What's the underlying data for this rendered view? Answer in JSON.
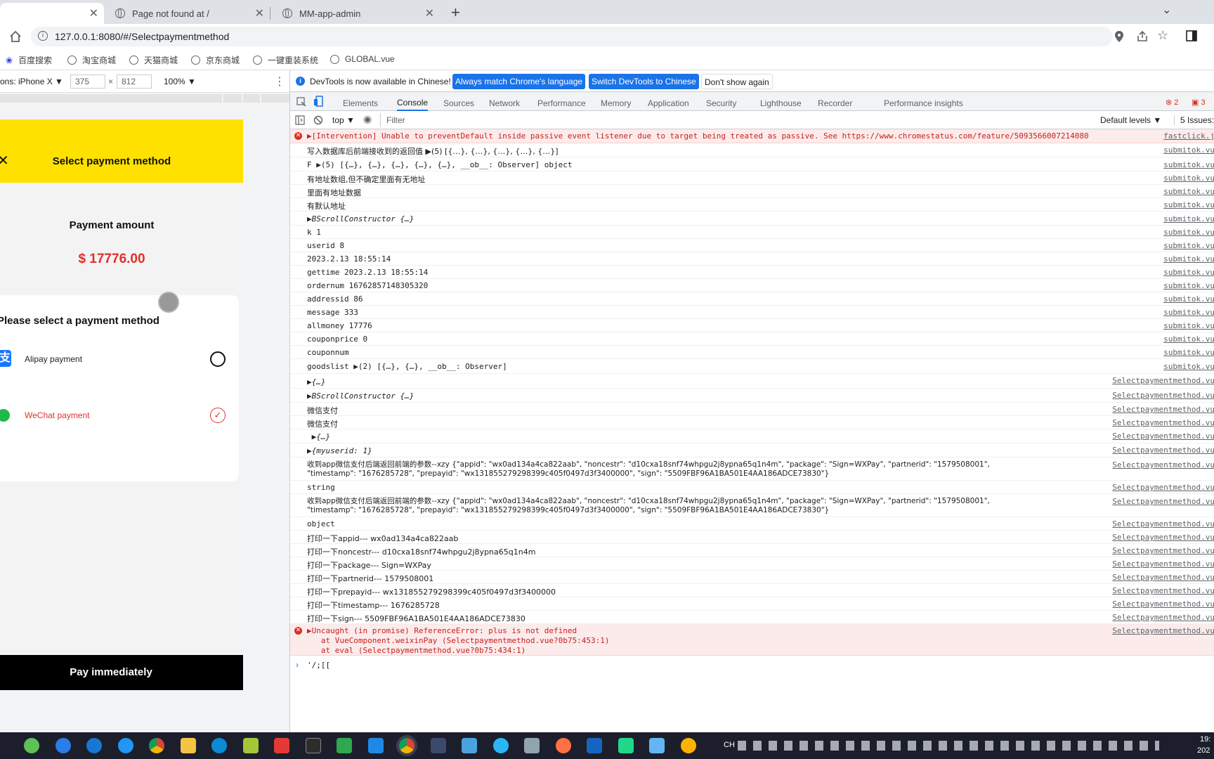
{
  "browser": {
    "tabs": [
      {
        "title": ""
      },
      {
        "title": "Page not found at /"
      },
      {
        "title": "MM-app-admin"
      }
    ],
    "url": "127.0.0.1:8080/#/Selectpaymentmethod",
    "bookmarks": [
      "百度搜索",
      "淘宝商城",
      "天猫商城",
      "京东商城",
      "一键重装系统",
      "GLOBAL.vue"
    ]
  },
  "device": {
    "label": "ons: iPhone X ▼",
    "width": "375",
    "height": "812",
    "zoom": "100% ▼"
  },
  "app": {
    "header_title": "Select payment method",
    "amount_label": "Payment amount",
    "amount_value": "$ 17776.00",
    "select_title": "Please select a payment method",
    "alipay_label": "Alipay payment",
    "alipay_icon": "支",
    "wechat_label": "WeChat payment",
    "pay_button": "Pay immediately",
    "colors": {
      "header": "#ffe100",
      "amount": "#e0312b",
      "wechat": "#e0312b",
      "pay_bg": "#000000"
    }
  },
  "devtools": {
    "banner_text": "DevTools is now available in Chinese!",
    "banner_btn1": "Always match Chrome's language",
    "banner_btn2": "Switch DevTools to Chinese",
    "banner_btn3": "Don't show again",
    "tabs": [
      "Elements",
      "Console",
      "Sources",
      "Network",
      "Performance",
      "Memory",
      "Application",
      "Security",
      "Lighthouse",
      "Recorder",
      "Performance insights"
    ],
    "error_count": "2",
    "warn_count": "3",
    "context": "top ▼",
    "filter_placeholder": "Filter",
    "levels": "Default levels ▼",
    "issues": "5 Issues:",
    "prompt": "'/;[["
  },
  "console": [
    {
      "type": "error",
      "msg": "▶[Intervention] Unable to preventDefault inside passive event listener due to target being treated as passive. See https://www.chromestatus.com/feature/5093566007214080",
      "src": "fastclick.j"
    },
    {
      "type": "log",
      "msg": "写入数据库后前端接收到的返回值 ▶(5) [{…}, {…}, {…}, {…}, {…}]",
      "src": "submitok.vu"
    },
    {
      "type": "log",
      "msg": "F ▶(5) [{…}, {…}, {…}, {…}, {…}, __ob__: Observer] object",
      "src": "submitok.vu"
    },
    {
      "type": "log",
      "msg": "有地址数组,但不确定里面有无地址",
      "src": "submitok.vu"
    },
    {
      "type": "log",
      "msg": "里面有地址数据",
      "src": "submitok.vu"
    },
    {
      "type": "log",
      "msg": "有默认地址",
      "src": "submitok.vu"
    },
    {
      "type": "log",
      "msg": "▶BScrollConstructor {…}",
      "src": "submitok.vu"
    },
    {
      "type": "log",
      "msg": "k 1",
      "src": "submitok.vu"
    },
    {
      "type": "log",
      "msg": "userid 8",
      "src": "submitok.vu"
    },
    {
      "type": "log",
      "msg": "2023.2.13 18:55:14",
      "src": "submitok.vu"
    },
    {
      "type": "log",
      "msg": "gettime 2023.2.13 18:55:14",
      "src": "submitok.vu"
    },
    {
      "type": "log",
      "msg": "ordernum 16762857148305320",
      "src": "submitok.vu"
    },
    {
      "type": "log",
      "msg": "addressid 86",
      "src": "submitok.vu"
    },
    {
      "type": "log",
      "msg": "message 333",
      "src": "submitok.vu"
    },
    {
      "type": "log",
      "msg": "allmoney 17776",
      "src": "submitok.vu"
    },
    {
      "type": "log",
      "msg": "couponprice 0",
      "src": "submitok.vu"
    },
    {
      "type": "log",
      "msg": "couponnum",
      "src": "submitok.vu"
    },
    {
      "type": "log",
      "msg": "goodslist ▶(2) [{…}, {…}, __ob__: Observer]",
      "src": "submitok.vu"
    },
    {
      "type": "log",
      "msg": "▶{…}",
      "src": "Selectpaymentmethod.vu"
    },
    {
      "type": "log",
      "msg": "▶BScrollConstructor {…}",
      "src": "Selectpaymentmethod.vu"
    },
    {
      "type": "log",
      "msg": "微信支付",
      "src": "Selectpaymentmethod.vu"
    },
    {
      "type": "log",
      "msg": "微信支付",
      "src": "Selectpaymentmethod.vu"
    },
    {
      "type": "log",
      "msg": " ▶{…}",
      "src": "Selectpaymentmethod.vu"
    },
    {
      "type": "log",
      "msg": "▶{myuserid: 1}",
      "src": "Selectpaymentmethod.vu"
    },
    {
      "type": "log2",
      "msg": "收到app微信支付后端返回前端的参数--xzy {\"appid\": \"wx0ad134a4ca822aab\", \"noncestr\": \"d10cxa18snf74whpgu2j8ypna65q1n4m\", \"package\": \"Sign=WXPay\", \"partnerid\": \"1579508001\",\n\"timestamp\": \"1676285728\", \"prepayid\": \"wx131855279298399c405f0497d3f3400000\", \"sign\": \"5509FBF96A1BA501E4AA186ADCE73830\"}",
      "src": "Selectpaymentmethod.vu"
    },
    {
      "type": "log",
      "msg": "string",
      "src": "Selectpaymentmethod.vu"
    },
    {
      "type": "log2",
      "msg": "收到app微信支付后端返回前端的参数--xzy {\"appid\": \"wx0ad134a4ca822aab\", \"noncestr\": \"d10cxa18snf74whpgu2j8ypna65q1n4m\", \"package\": \"Sign=WXPay\", \"partnerid\": \"1579508001\",\n\"timestamp\": \"1676285728\", \"prepayid\": \"wx131855279298399c405f0497d3f3400000\", \"sign\": \"5509FBF96A1BA501E4AA186ADCE73830\"}",
      "src": "Selectpaymentmethod.vu"
    },
    {
      "type": "log",
      "msg": "object",
      "src": "Selectpaymentmethod.vu"
    },
    {
      "type": "log",
      "msg": "打印一下appid--- wx0ad134a4ca822aab",
      "src": "Selectpaymentmethod.vu"
    },
    {
      "type": "log",
      "msg": "打印一下noncestr--- d10cxa18snf74whpgu2j8ypna65q1n4m",
      "src": "Selectpaymentmethod.vu"
    },
    {
      "type": "log",
      "msg": "打印一下package--- Sign=WXPay",
      "src": "Selectpaymentmethod.vu"
    },
    {
      "type": "log",
      "msg": "打印一下partnerid--- 1579508001",
      "src": "Selectpaymentmethod.vu"
    },
    {
      "type": "log",
      "msg": "打印一下prepayid--- wx131855279298399c405f0497d3f3400000",
      "src": "Selectpaymentmethod.vu"
    },
    {
      "type": "log",
      "msg": "打印一下timestamp--- 1676285728",
      "src": "Selectpaymentmethod.vu"
    },
    {
      "type": "log",
      "msg": "打印一下sign--- 5509FBF96A1BA501E4AA186ADCE73830",
      "src": "Selectpaymentmethod.vu"
    },
    {
      "type": "error3",
      "msg": "▶Uncaught (in promise) ReferenceError: plus is not defined\n   at VueComponent.weixinPay (Selectpaymentmethod.vue?0b75:453:1)\n   at eval (Selectpaymentmethod.vue?0b75:434:1)",
      "src": "Selectpaymentmethod.vu"
    }
  ],
  "taskbar": {
    "tray_text": "CH",
    "clock_top": "19:",
    "clock_bottom": "202"
  }
}
